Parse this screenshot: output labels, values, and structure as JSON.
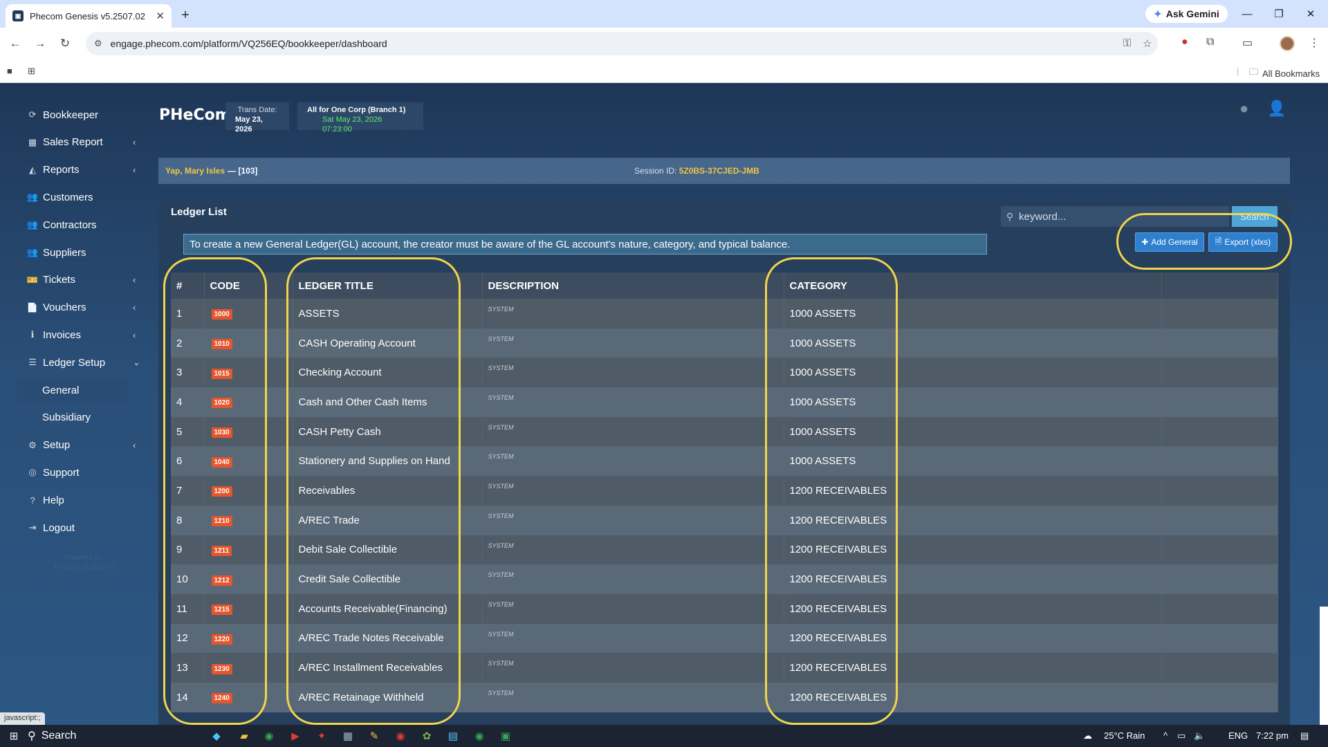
{
  "browser": {
    "tab_title": "Phecom Genesis v5.2507.02",
    "url": "engage.phecom.com/platform/VQ256EQ/bookkeeper/dashboard",
    "ask_gemini": "Ask Gemini",
    "all_bookmarks": "All Bookmarks"
  },
  "sidebar": {
    "items": [
      {
        "label": "Bookkeeper",
        "icon": "refresh-icon",
        "glyph": "⟳",
        "chevron": ""
      },
      {
        "label": "Sales Report",
        "icon": "table-icon",
        "glyph": "▦",
        "chevron": "‹"
      },
      {
        "label": "Reports",
        "icon": "area-chart-icon",
        "glyph": "◭",
        "chevron": "‹"
      },
      {
        "label": "Customers",
        "icon": "users-icon",
        "glyph": "👥",
        "chevron": ""
      },
      {
        "label": "Contractors",
        "icon": "users-icon",
        "glyph": "👥",
        "chevron": ""
      },
      {
        "label": "Suppliers",
        "icon": "users-icon",
        "glyph": "👥",
        "chevron": ""
      },
      {
        "label": "Tickets",
        "icon": "ticket-icon",
        "glyph": "🎫",
        "chevron": "‹"
      },
      {
        "label": "Vouchers",
        "icon": "file-icon",
        "glyph": "📄",
        "chevron": "‹"
      },
      {
        "label": "Invoices",
        "icon": "info-icon",
        "glyph": "ℹ",
        "chevron": "‹"
      },
      {
        "label": "Ledger Setup",
        "icon": "list-icon",
        "glyph": "☰",
        "chevron": "⌄"
      }
    ],
    "sub_items": [
      "General",
      "Subsidiary"
    ],
    "items_bottom": [
      {
        "label": "Setup",
        "icon": "cogs-icon",
        "glyph": "⚙",
        "chevron": "‹"
      },
      {
        "label": "Support",
        "icon": "lifebuoy-icon",
        "glyph": "◎",
        "chevron": ""
      },
      {
        "label": "Help",
        "icon": "question-icon",
        "glyph": "?",
        "chevron": ""
      },
      {
        "label": "Logout",
        "icon": "logout-icon",
        "glyph": "⇥",
        "chevron": ""
      }
    ],
    "powered_by": "Powered by:",
    "powered_version": "Phecom v5.2507.02"
  },
  "header": {
    "brand": "PHeCom",
    "trans_date_label": "Trans Date:",
    "trans_date_value": "May 23, 2026",
    "branch": "All for One Corp (Branch 1)",
    "datetime": "Sat May 23, 2026 07:23:00"
  },
  "userbar": {
    "name": "Yap, Mary Isles",
    "code": "— [103]",
    "session_label": "Session ID:",
    "session_id": "5Z0BS-37CJED-JMB"
  },
  "ledger": {
    "title": "Ledger List",
    "search_placeholder": "keyword...",
    "search_button": "Search",
    "notice": "To create a new General Ledger(GL) account, the creator must be aware of the GL account's nature, category, and typical balance.",
    "add_button": "Add General",
    "export_button": "Export (xlxs)",
    "columns": [
      "#",
      "CODE",
      "LEDGER TITLE",
      "DESCRIPTION",
      "CATEGORY",
      ""
    ],
    "rows": [
      {
        "num": "1",
        "code": "1000",
        "title": "ASSETS",
        "desc": "SYSTEM",
        "category": "1000 ASSETS"
      },
      {
        "num": "2",
        "code": "1010",
        "title": "CASH Operating Account",
        "desc": "SYSTEM",
        "category": "1000 ASSETS"
      },
      {
        "num": "3",
        "code": "1015",
        "title": "Checking Account",
        "desc": "SYSTEM",
        "category": "1000 ASSETS"
      },
      {
        "num": "4",
        "code": "1020",
        "title": "Cash and Other Cash Items",
        "desc": "SYSTEM",
        "category": "1000 ASSETS"
      },
      {
        "num": "5",
        "code": "1030",
        "title": "CASH Petty Cash",
        "desc": "SYSTEM",
        "category": "1000 ASSETS"
      },
      {
        "num": "6",
        "code": "1040",
        "title": "Stationery and Supplies on Hand",
        "desc": "SYSTEM",
        "category": "1000 ASSETS"
      },
      {
        "num": "7",
        "code": "1200",
        "title": "Receivables",
        "desc": "SYSTEM",
        "category": "1200 RECEIVABLES"
      },
      {
        "num": "8",
        "code": "1210",
        "title": "A/REC Trade",
        "desc": "SYSTEM",
        "category": "1200 RECEIVABLES"
      },
      {
        "num": "9",
        "code": "1211",
        "title": "Debit Sale Collectible",
        "desc": "SYSTEM",
        "category": "1200 RECEIVABLES"
      },
      {
        "num": "10",
        "code": "1212",
        "title": "Credit Sale Collectible",
        "desc": "SYSTEM",
        "category": "1200 RECEIVABLES"
      },
      {
        "num": "11",
        "code": "1215",
        "title": "Accounts Receivable(Financing)",
        "desc": "SYSTEM",
        "category": "1200 RECEIVABLES"
      },
      {
        "num": "12",
        "code": "1220",
        "title": "A/REC Trade Notes Receivable",
        "desc": "SYSTEM",
        "category": "1200 RECEIVABLES"
      },
      {
        "num": "13",
        "code": "1230",
        "title": "A/REC Installment Receivables",
        "desc": "SYSTEM",
        "category": "1200 RECEIVABLES"
      },
      {
        "num": "14",
        "code": "1240",
        "title": "A/REC Retainage Withheld",
        "desc": "SYSTEM",
        "category": "1200 RECEIVABLES"
      }
    ]
  },
  "statusbar": {
    "link": "javascript:;"
  },
  "taskbar": {
    "search": "Search",
    "weather": "25°C  Rain",
    "lang": "ENG",
    "time": "7:22 pm"
  },
  "colors": {
    "accent_yellow": "#f2d54a",
    "badge_red": "#e4572e",
    "button_blue": "#2f7fcf",
    "name_gold": "#f2c640"
  }
}
